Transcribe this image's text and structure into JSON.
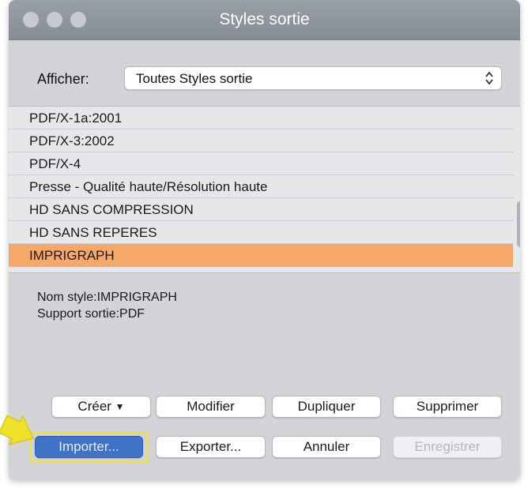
{
  "window": {
    "title": "Styles sortie"
  },
  "filter": {
    "label": "Afficher:",
    "value": "Toutes Styles sortie"
  },
  "styles_list": [
    {
      "label": "PDF/X-1a:2001",
      "selected": false
    },
    {
      "label": "PDF/X-3:2002",
      "selected": false
    },
    {
      "label": "PDF/X-4",
      "selected": false
    },
    {
      "label": "Presse - Qualité haute/Résolution haute",
      "selected": false
    },
    {
      "label": "HD SANS COMPRESSION",
      "selected": false
    },
    {
      "label": "HD SANS REPERES",
      "selected": false
    },
    {
      "label": "IMPRIGRAPH",
      "selected": true
    }
  ],
  "details": {
    "name_line": "Nom style:IMPRIGRAPH",
    "support_line": "Support sortie:PDF"
  },
  "buttons": {
    "creer": "Créer",
    "modifier": "Modifier",
    "dupliquer": "Dupliquer",
    "supprimer": "Supprimer",
    "importer": "Importer...",
    "exporter": "Exporter...",
    "annuler": "Annuler",
    "enregistrer": "Enregistrer"
  },
  "colors": {
    "selection": "#f5a867",
    "primary_button": "#3f73c8",
    "highlight": "#f0e22a"
  }
}
